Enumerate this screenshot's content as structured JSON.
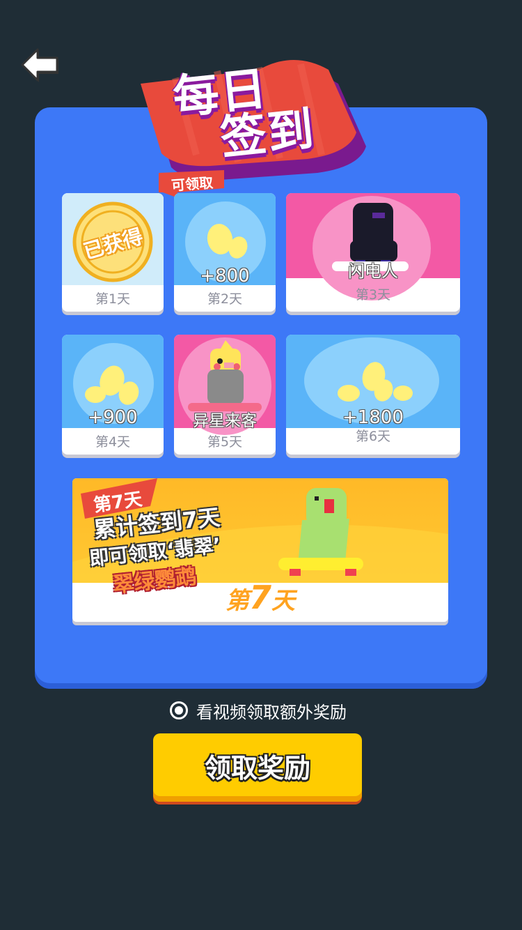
{
  "header": {
    "back_icon": "back-arrow-icon",
    "title_line1": "每日",
    "title_line2": "签到",
    "claimable_tag": "可领取"
  },
  "days": [
    {
      "day": "第1天",
      "status": "已获得",
      "reward_type": "claimed",
      "color": "#d0ecfa"
    },
    {
      "day": "第2天",
      "amount": "+800",
      "reward_type": "seeds",
      "color": "#5ab4f8"
    },
    {
      "day": "第3天",
      "name": "闪电人",
      "reward_type": "character",
      "color": "#f359a5"
    },
    {
      "day": "第4天",
      "amount": "+900",
      "reward_type": "seeds",
      "color": "#5ab4f8"
    },
    {
      "day": "第5天",
      "name": "异星来客",
      "reward_type": "character",
      "color": "#f359a5"
    },
    {
      "day": "第6天",
      "amount": "+1800",
      "reward_type": "seeds",
      "color": "#5ab4f8"
    }
  ],
  "day7": {
    "ribbon": "第7天",
    "line1": "累计签到7天",
    "line2": "即可领取‘翡翠’",
    "line3": "翠绿鹦鹉",
    "day_prefix": "第",
    "day_num": "7",
    "day_suffix": "天"
  },
  "video_option": {
    "label": "看视频领取额外奖励",
    "checked": true
  },
  "claim_button": {
    "label": "领取奖励"
  },
  "colors": {
    "background": "#1f2d36",
    "panel": "#3d78f7",
    "title_banner": "#e84a3c",
    "button": "#ffcc00"
  }
}
